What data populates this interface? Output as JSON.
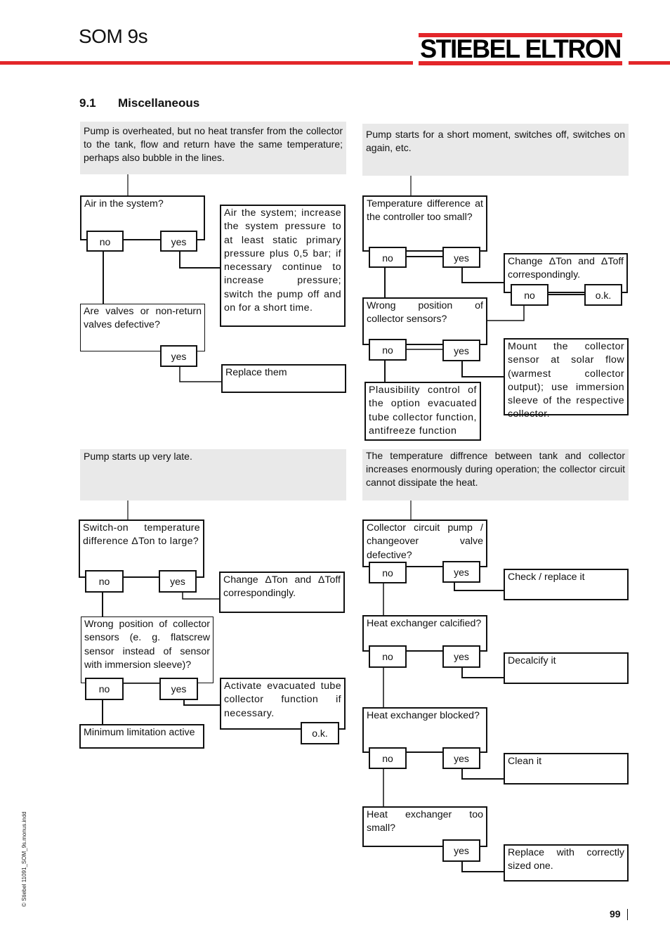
{
  "header": {
    "doc_title": "SOM 9s",
    "brand": "STIEBEL ELTRON",
    "brand_color": "#e3262a"
  },
  "section": {
    "number": "9.1",
    "title": "Miscellaneous"
  },
  "flow1": {
    "problem": "Pump is overheated, but no heat transfer from the collector to the tank, flow and return have the same temperature; perhaps also bubble in the lines.",
    "q1": "Air in the system?",
    "q1_no": "no",
    "q1_yes": "yes",
    "q1_action": "Air the system; increase the system pressure to at least static primary pressure plus 0,5 bar; if necessary continue to increase pressure; switch the pump off and on for a short time.",
    "q2": "Are valves or non-return valves defective?",
    "q2_yes": "yes",
    "q2_action": "Replace them"
  },
  "flow2": {
    "problem": "Pump starts for a short moment, switches off, switches on again, etc.",
    "q1": "Temperature difference at the controller too small?",
    "q1_no": "no",
    "q1_yes": "yes",
    "q1_action": "Change ΔTon and ΔToff correspondingly.",
    "q1_action_no": "no",
    "q1_action_ok": "o.k.",
    "q2": "Wrong position of collector sensors?",
    "q2_no": "no",
    "q2_yes": "yes",
    "q2_action": "Mount the collector sensor at solar flow (warmest collector output); use immersion sleeve of the respective collector.",
    "q2_no_action": "Plausibility control of the option evacuated tube collector function, antifreeze function"
  },
  "flow3": {
    "problem": "Pump starts up very late.",
    "q1": "Switch-on temperature difference ΔTon to large?",
    "q1_no": "no",
    "q1_yes": "yes",
    "q1_action": "Change ΔTon and ΔToff correspondingly.",
    "q2": "Wrong position of collector sensors (e. g. flatscrew sensor instead of sensor with immersion sleeve)?",
    "q2_no": "no",
    "q2_yes": "yes",
    "q2_action": "Activate evacuated tube collector function if necessary.",
    "q2_action_ok": "o.k.",
    "q2_no_action": "Minimum limitation active"
  },
  "flow4": {
    "problem": "The temperature diffrence between tank and collector increases enormously during operation; the collector circuit cannot dissipate the heat.",
    "q1": "Collector circuit pump / changeover valve defective?",
    "q1_no": "no",
    "q1_yes": "yes",
    "q1_action": "Check / replace it",
    "q2": "Heat exchanger calcified?",
    "q2_no": "no",
    "q2_yes": "yes",
    "q2_action": "Decalcify it",
    "q3": "Heat exchanger blocked?",
    "q3_no": "no",
    "q3_yes": "yes",
    "q3_action": "Clean it",
    "q4": "Heat exchanger too small?",
    "q4_yes": "yes",
    "q4_action": "Replace with correctly sized one."
  },
  "footer": {
    "side_text": "© Stiebel 11091_SOM_9s.monus.indd",
    "page_number": "99"
  }
}
